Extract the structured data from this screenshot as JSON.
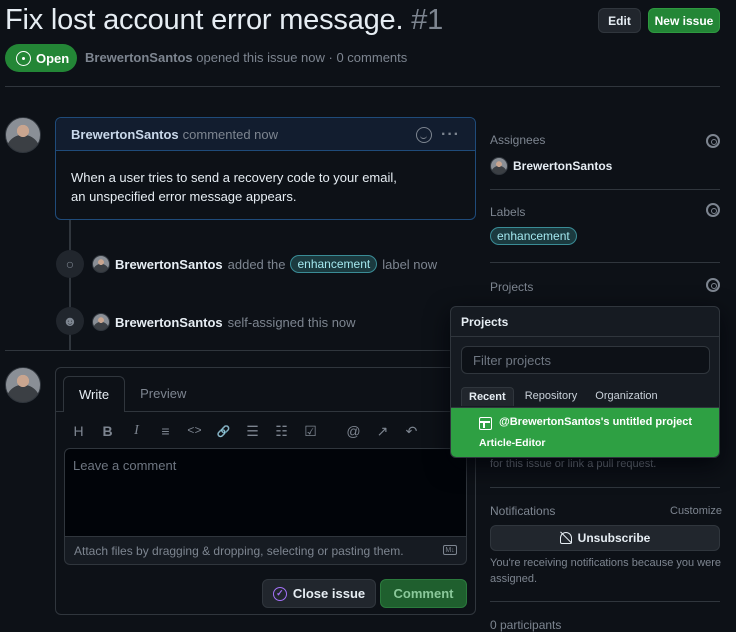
{
  "issue": {
    "title": "Fix lost account error message.",
    "number": "#1",
    "state": "Open",
    "author": "BrewertonSantos",
    "meta_rest": "opened this issue now · 0 comments"
  },
  "header_buttons": {
    "edit": "Edit",
    "new_issue": "New issue"
  },
  "comment": {
    "author": "BrewertonSantos",
    "time": "commented now",
    "body": "When a user tries to send a recovery code to your email, an unspecified error message appears.",
    "menu": "···"
  },
  "events": [
    {
      "user": "BrewertonSantos",
      "text_before": "added the",
      "label": "enhancement",
      "text_after": "label now"
    },
    {
      "user": "BrewertonSantos",
      "text": "self-assigned this now"
    }
  ],
  "editor": {
    "tabs": [
      "Write",
      "Preview"
    ],
    "placeholder": "Leave a comment",
    "attach": "Attach files by dragging & dropping, selecting or pasting them.",
    "toolbar": [
      "H",
      "B",
      "I",
      "≡",
      "<>",
      "🔗",
      "☰",
      "☷",
      "☑",
      "@",
      "↗",
      "↶"
    ],
    "close_button": "Close issue",
    "comment_button": "Comment"
  },
  "sidebar": {
    "assignees_heading": "Assignees",
    "assignee": "BrewertonSantos",
    "labels_heading": "Labels",
    "label": "enhancement",
    "projects_heading": "Projects",
    "projects_hint": "for this issue or link a pull request.",
    "notifications_heading": "Notifications",
    "customize": "Customize",
    "unsubscribe": "Unsubscribe",
    "notif_text": "You're receiving notifications because you were assigned.",
    "participants": "0 participants"
  },
  "projects_popup": {
    "title": "Projects",
    "filter_placeholder": "Filter projects",
    "tabs": [
      "Recent",
      "Repository",
      "Organization"
    ],
    "selected_project": "@BrewertonSantos's untitled project",
    "selected_sub": "Article-Editor"
  },
  "colors": {
    "accent_green": "#238636",
    "label_bg": "#1b3a3f",
    "popup_select": "#2ea043",
    "comment_border": "#1f4b7a"
  }
}
